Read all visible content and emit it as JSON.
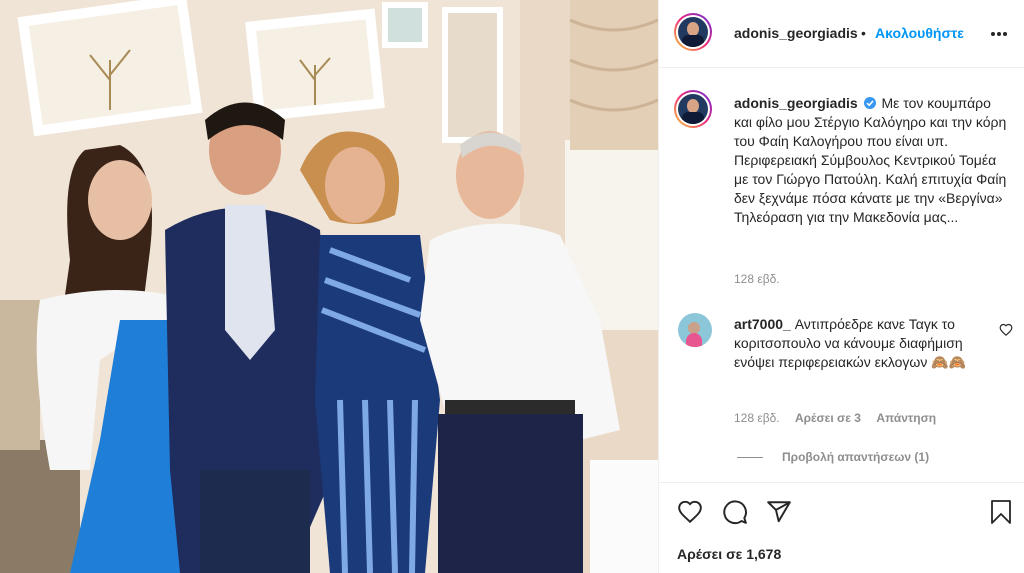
{
  "post": {
    "author": "adonis_georgiadis",
    "follow_label": "Ακολουθήστε",
    "separator": "•",
    "caption_author": "adonis_georgiadis",
    "caption": "Με τον κουμπάρο και φίλο μου Στέργιο Καλόγηρο και την κόρη του Φαίη Καλογήρου που είναι υπ. Περιφερειακή Σύμβουλος Κεντρικού Τομέα με τον Γιώργο Πατούλη. Καλή επιτυχία Φαίη δεν ξεχνάμε πόσα κάνατε με την «Βεργίνα» Τηλεόραση για την Μακεδονία μας...",
    "caption_time": "128 εβδ.",
    "likes_text": "Αρέσει σε 1,678"
  },
  "comment": {
    "author": "art7000_",
    "text": "Αντιπρόεδρε κανε Ταγκ το κοριτσοπουλο να κάνουμε διαφήμιση ενόψει περιφερειακών εκλογων 🙈🙈",
    "time": "128 εβδ.",
    "likes": "Αρέσει σε 3",
    "reply": "Απάντηση",
    "view_replies": "Προβολή απαντήσεων (1)"
  },
  "icons": {
    "more": "more-options-icon",
    "verified": "verified-badge-icon",
    "like": "heart-icon",
    "comment": "comment-icon",
    "share": "share-icon",
    "save": "bookmark-icon",
    "comment_like": "small-heart-icon"
  },
  "colors": {
    "accent": "#0095f6",
    "verified": "#3897f0",
    "text": "#262626",
    "muted": "#8e8e8e"
  }
}
